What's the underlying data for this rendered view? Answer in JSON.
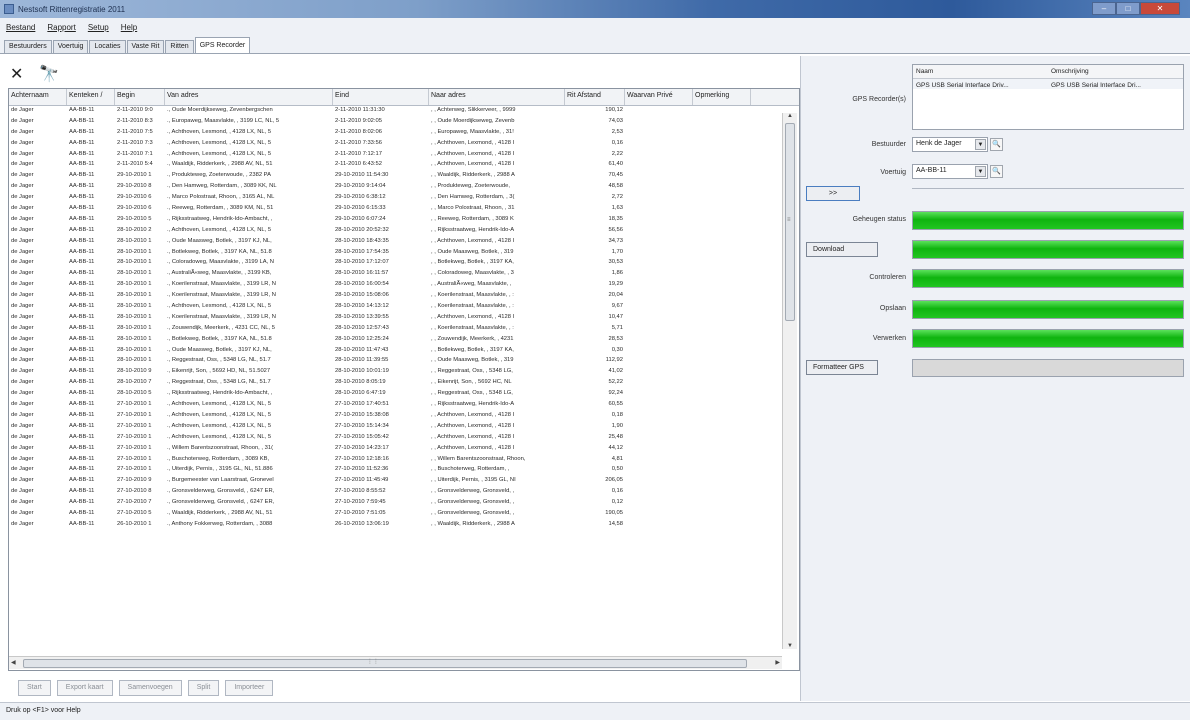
{
  "window": {
    "title": "Nestsoft Rittenregistratie 2011"
  },
  "menu": [
    "Bestand",
    "Rapport",
    "Setup",
    "Help"
  ],
  "tabs": [
    "Bestuurders",
    "Voertuig",
    "Locaties",
    "Vaste Rit",
    "Ritten",
    "GPS Recorder"
  ],
  "active_tab": "GPS Recorder",
  "toolbar": {
    "delete_glyph": "✕",
    "find_glyph": "🔭"
  },
  "grid": {
    "columns": [
      "Achternaam",
      "Kenteken /",
      "Begin",
      "Van adres",
      "Eind",
      "Naar adres",
      "Rit Afstand",
      "Waarvan Privé",
      "Opmerking"
    ],
    "rows": [
      [
        "de Jager",
        "AA-BB-11",
        "2-11-2010 9:0",
        "., Oude Moerdijkseweg, Zevenbergschen",
        "2-11-2010 11:31:30",
        ", , Achterweg, Slikkerveer, , 9999",
        "190,12",
        "",
        ""
      ],
      [
        "de Jager",
        "AA-BB-11",
        "2-11-2010 8:3",
        "., Europaweg, Maasvlakte, , 3199 LC, NL, 5",
        "2-11-2010 9:02:05",
        ", , Oude Moerdijkseweg, Zevenb",
        "74,03",
        "",
        ""
      ],
      [
        "de Jager",
        "AA-BB-11",
        "2-11-2010 7:5",
        "., Achthoven, Lexmond, , 4128 LX, NL, 5",
        "2-11-2010 8:02:06",
        ", , Europaweg, Maasvlakte, , 31!",
        "2,53",
        "",
        ""
      ],
      [
        "de Jager",
        "AA-BB-11",
        "2-11-2010 7:3",
        "., Achthoven, Lexmond, , 4128 LX, NL, 5",
        "2-11-2010 7:33:56",
        ", , Achthoven, Lexmond, , 4128 I",
        "0,16",
        "",
        ""
      ],
      [
        "de Jager",
        "AA-BB-11",
        "2-11-2010 7:1",
        "., Achthoven, Lexmond, , 4128 LX, NL, 5",
        "2-11-2010 7:12:17",
        ", , Achthoven, Lexmond, , 4128 I",
        "2,22",
        "",
        ""
      ],
      [
        "de Jager",
        "AA-BB-11",
        "2-11-2010 5:4",
        "., Waaldijk, Ridderkerk, , 2988 AV, NL, 51",
        "2-11-2010 6:43:52",
        ", , Achthoven, Lexmond, , 4128 I",
        "61,40",
        "",
        ""
      ],
      [
        "de Jager",
        "AA-BB-11",
        "29-10-2010 1",
        "., Produkteweg, Zoeterwoude, , 2382 PA",
        "29-10-2010 11:54:30",
        ", , Waaldijk, Ridderkerk, , 2988 A",
        "70,45",
        "",
        ""
      ],
      [
        "de Jager",
        "AA-BB-11",
        "29-10-2010 8",
        "., Den Hamweg, Rotterdam, , 3089 KK, NL",
        "29-10-2010 9:14:04",
        ", , Produkteweg, Zoeterwoude,",
        "48,58",
        "",
        ""
      ],
      [
        "de Jager",
        "AA-BB-11",
        "29-10-2010 6",
        "., Marco Polostraat, Rhoon, , 3165 AL, NL",
        "29-10-2010 6:38:12",
        ", , Den Hamweg, Rotterdam, , 3(",
        "2,72",
        "",
        ""
      ],
      [
        "de Jager",
        "AA-BB-11",
        "29-10-2010 6",
        "., Reeweg, Rotterdam, , 3089 KM, NL, 51",
        "29-10-2010 6:15:33",
        ", , Marco Polostraat, Rhoon, , 31",
        "1,63",
        "",
        ""
      ],
      [
        "de Jager",
        "AA-BB-11",
        "29-10-2010 5",
        "., Rijksstraatweg, Hendrik-Ido-Ambacht, ,",
        "29-10-2010 6:07:24",
        ", , Reeweg, Rotterdam, , 3089 K",
        "18,35",
        "",
        ""
      ],
      [
        "de Jager",
        "AA-BB-11",
        "28-10-2010 2",
        "., Achthoven, Lexmond, , 4128 LX, NL, 5",
        "28-10-2010 20:52:32",
        ", , Rijksstraatweg, Hendrik-Ido-A",
        "56,56",
        "",
        ""
      ],
      [
        "de Jager",
        "AA-BB-11",
        "28-10-2010 1",
        "., Oude Maasweg, Botlek, , 3197 KJ, NL,",
        "28-10-2010 18:43:35",
        ", , Achthoven, Lexmond, , 4128 I",
        "34,73",
        "",
        ""
      ],
      [
        "de Jager",
        "AA-BB-11",
        "28-10-2010 1",
        "., Botlekweg, Botlek, , 3197 KA, NL, 51.8",
        "28-10-2010 17:54:35",
        ", , Oude Maasweg, Botlek, , 319",
        "1,70",
        "",
        ""
      ],
      [
        "de Jager",
        "AA-BB-11",
        "28-10-2010 1",
        "., Coloradoweg, Maasvlakte, , 3199 LA, N",
        "28-10-2010 17:12:07",
        ", , Botlekweg, Botlek, , 3197 KA,",
        "30,53",
        "",
        ""
      ],
      [
        "de Jager",
        "AA-BB-11",
        "28-10-2010 1",
        "., AustraliÃ«weg, Maasvlakte, , 3199 KB,",
        "28-10-2010 16:11:57",
        ", , Coloradoweg, Maasvlakte, , 3",
        "1,86",
        "",
        ""
      ],
      [
        "de Jager",
        "AA-BB-11",
        "28-10-2010 1",
        "., Koerilenstraat, Maasvlakte, , 3199 LR, N",
        "28-10-2010 16:00:54",
        ", , AustraliÃ«weg, Maasvlakte, ,",
        "19,29",
        "",
        ""
      ],
      [
        "de Jager",
        "AA-BB-11",
        "28-10-2010 1",
        "., Koerilenstraat, Maasvlakte, , 3199 LR, N",
        "28-10-2010 15:08:06",
        ", , Koerilenstraat, Maasvlakte, , :",
        "20,04",
        "",
        ""
      ],
      [
        "de Jager",
        "AA-BB-11",
        "28-10-2010 1",
        "., Achthoven, Lexmond, , 4128 LX, NL, 5",
        "28-10-2010 14:13:12",
        ", , Koerilenstraat, Maasvlakte, , :",
        "9,67",
        "",
        ""
      ],
      [
        "de Jager",
        "AA-BB-11",
        "28-10-2010 1",
        "., Koerilenstraat, Maasvlakte, , 3199 LR, N",
        "28-10-2010 13:39:55",
        ", , Achthoven, Lexmond, , 4128 I",
        "10,47",
        "",
        ""
      ],
      [
        "de Jager",
        "AA-BB-11",
        "28-10-2010 1",
        "., Zouwendijk, Meerkerk, , 4231 CC, NL, 5",
        "28-10-2010 12:57:43",
        ", , Koerilenstraat, Maasvlakte, , :",
        "5,71",
        "",
        ""
      ],
      [
        "de Jager",
        "AA-BB-11",
        "28-10-2010 1",
        "., Botlekweg, Botlek, , 3197 KA, NL, 51.8",
        "28-10-2010 12:25:24",
        ", , Zouwendijk, Meerkerk, , 4231",
        "28,53",
        "",
        ""
      ],
      [
        "de Jager",
        "AA-BB-11",
        "28-10-2010 1",
        "., Oude Maasweg, Botlek, , 3197 KJ, NL,",
        "28-10-2010 11:47:43",
        ", , Botlekweg, Botlek, , 3197 KA,",
        "0,30",
        "",
        ""
      ],
      [
        "de Jager",
        "AA-BB-11",
        "28-10-2010 1",
        "., Reggestraat, Oss, , 5348 LG, NL, 51.7",
        "28-10-2010 11:39:55",
        ", , Oude Maasweg, Botlek, , 319",
        "112,92",
        "",
        ""
      ],
      [
        "de Jager",
        "AA-BB-11",
        "28-10-2010 9",
        "., Eikenrijt, Son, , 5692 HD, NL, 51.5027",
        "28-10-2010 10:01:19",
        ", , Reggestraat, Oss, , 5348 LG,",
        "41,02",
        "",
        ""
      ],
      [
        "de Jager",
        "AA-BB-11",
        "28-10-2010 7",
        "., Reggestraat, Oss, , 5348 LG, NL, 51.7",
        "28-10-2010 8:05:19",
        ", , Eikenrijt, Son, , 5692 HC, NL",
        "52,22",
        "",
        ""
      ],
      [
        "de Jager",
        "AA-BB-11",
        "28-10-2010 5",
        "., Rijksstraatweg, Hendrik-Ido-Ambacht, ,",
        "28-10-2010 6:47:19",
        ", , Reggestraat, Oss, , 5348 LG,",
        "92,24",
        "",
        ""
      ],
      [
        "de Jager",
        "AA-BB-11",
        "27-10-2010 1",
        "., Achthoven, Lexmond, , 4128 LX, NL, 5",
        "27-10-2010 17:40:51",
        ", , Rijksstraatweg, Hendrik-Ido-A",
        "60,55",
        "",
        ""
      ],
      [
        "de Jager",
        "AA-BB-11",
        "27-10-2010 1",
        "., Achthoven, Lexmond, , 4128 LX, NL, 5",
        "27-10-2010 15:38:08",
        ", , Achthoven, Lexmond, , 4128 I",
        "0,18",
        "",
        ""
      ],
      [
        "de Jager",
        "AA-BB-11",
        "27-10-2010 1",
        "., Achthoven, Lexmond, , 4128 LX, NL, 5",
        "27-10-2010 15:14:34",
        ", , Achthoven, Lexmond, , 4128 I",
        "1,90",
        "",
        ""
      ],
      [
        "de Jager",
        "AA-BB-11",
        "27-10-2010 1",
        "., Achthoven, Lexmond, , 4128 LX, NL, 5",
        "27-10-2010 15:05:42",
        ", , Achthoven, Lexmond, , 4128 I",
        "25,48",
        "",
        ""
      ],
      [
        "de Jager",
        "AA-BB-11",
        "27-10-2010 1",
        "., Willem Barentszoonstraat, Rhoon, , 31(",
        "27-10-2010 14:23:17",
        ", , Achthoven, Lexmond, , 4128 I",
        "44,12",
        "",
        ""
      ],
      [
        "de Jager",
        "AA-BB-11",
        "27-10-2010 1",
        "., Buschoterweg, Rotterdam, , 3089 KB,",
        "27-10-2010 12:18:16",
        ", , Willem Barentszoonstraat, Rhoon,",
        "4,81",
        "",
        ""
      ],
      [
        "de Jager",
        "AA-BB-11",
        "27-10-2010 1",
        "., Uiterdijk, Pernis, , 3195 GL, NL, 51.886",
        "27-10-2010 11:52:36",
        ", , Buschoterweg, Rotterdam, ,",
        "0,50",
        "",
        ""
      ],
      [
        "de Jager",
        "AA-BB-11",
        "27-10-2010 9",
        "., Burgemeester van Laarstraat, Gronevel",
        "27-10-2010 11:45:49",
        ", , Uiterdijk, Pernis, , 3195 GL, NI",
        "206,05",
        "",
        ""
      ],
      [
        "de Jager",
        "AA-BB-11",
        "27-10-2010 8",
        "., Gronsvelderweg, Gronsveld, , 6247 ER,",
        "27-10-2010 8:55:52",
        ", , Gronsvelderweg, Gronsveld, ,",
        "0,16",
        "",
        ""
      ],
      [
        "de Jager",
        "AA-BB-11",
        "27-10-2010 7",
        "., Gronsvelderweg, Gronsveld, , 6247 ER,",
        "27-10-2010 7:59:45",
        ", , Gronsvelderweg, Gronsveld, ,",
        "0,12",
        "",
        ""
      ],
      [
        "de Jager",
        "AA-BB-11",
        "27-10-2010 5",
        "., Waaldijk, Ridderkerk, , 2988 AV, NL, 51",
        "27-10-2010 7:51:05",
        ", , Gronsvelderweg, Gronsveld, ,",
        "190,05",
        "",
        ""
      ],
      [
        "de Jager",
        "AA-BB-11",
        "26-10-2010 1",
        "., Anthony Fokkerweg, Rotterdam, , 3088",
        "26-10-2010 13:06:19",
        ", , Waaldijk, Ridderkerk, , 2988 A",
        "14,58",
        "",
        ""
      ]
    ]
  },
  "bottom_buttons": [
    "Start",
    "Export kaart",
    "Samenvoegen",
    "Split",
    "Importeer"
  ],
  "status_text": "Druk op <F1> voor Help",
  "gps": {
    "recorder_label": "GPS Recorder(s)",
    "recorder_columns": [
      "Naam",
      "Omschrijving"
    ],
    "recorder_row": [
      "GPS USB Serial Interface Driv...",
      "GPS USB Serial Interface Dri..."
    ],
    "bestuurder_label": "Bestuurder",
    "bestuurder_value": "Henk de Jager",
    "voertuig_label": "Voertuig",
    "voertuig_value": "AA-BB-11",
    "next_button": ">>",
    "geheugen_label": "Geheugen status",
    "download_button": "Download",
    "controleren_label": "Controleren",
    "opslaan_label": "Opslaan",
    "verwerken_label": "Verwerken",
    "formatteer_button": "Formatteer GPS",
    "progress": {
      "geheugen": 1.0,
      "download": 1.0,
      "controleren": 1.0,
      "opslaan": 1.0,
      "verwerken": 1.0,
      "formatteer": 0.0
    },
    "colors": {
      "progress_fill": "#22c622"
    }
  }
}
